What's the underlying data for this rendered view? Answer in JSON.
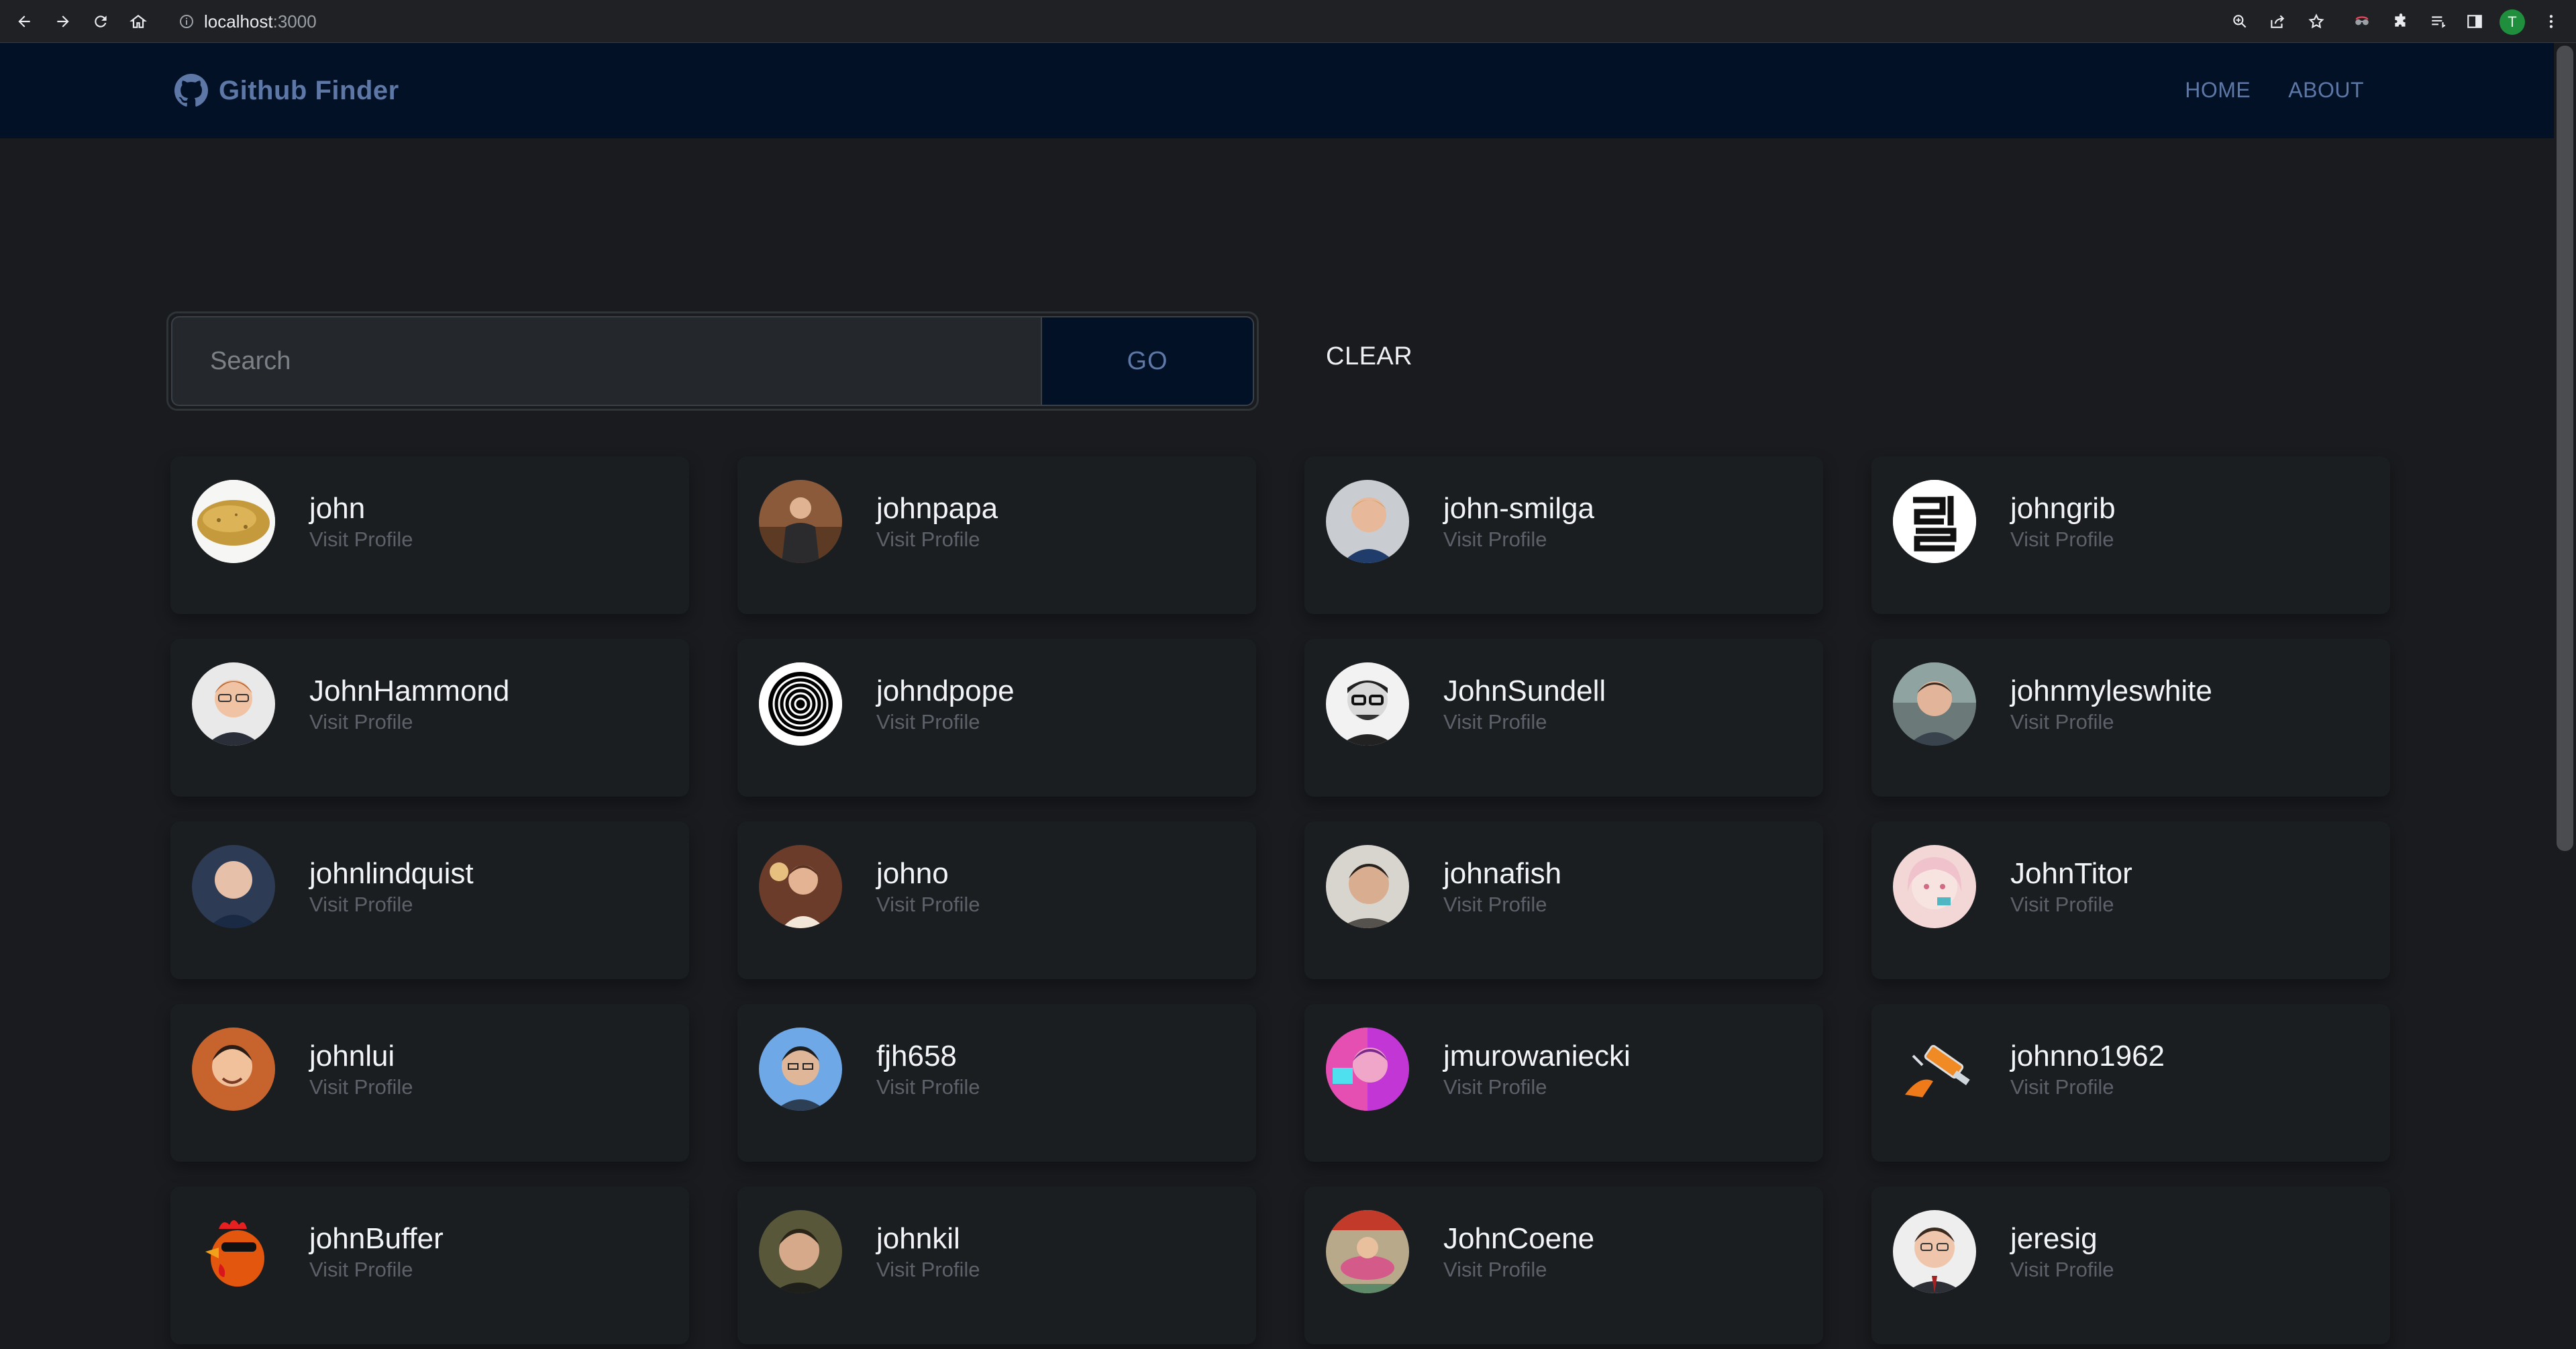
{
  "browser": {
    "url_host": "localhost",
    "url_port": ":3000",
    "profile_initial": "T"
  },
  "navbar": {
    "brand": "Github Finder",
    "links": [
      "HOME",
      "ABOUT"
    ]
  },
  "search": {
    "placeholder": "Search",
    "go_label": "GO",
    "clear_label": "CLEAR"
  },
  "users": [
    {
      "login": "john",
      "link_label": "Visit Profile"
    },
    {
      "login": "johnpapa",
      "link_label": "Visit Profile"
    },
    {
      "login": "john-smilga",
      "link_label": "Visit Profile"
    },
    {
      "login": "johngrib",
      "link_label": "Visit Profile"
    },
    {
      "login": "JohnHammond",
      "link_label": "Visit Profile"
    },
    {
      "login": "johndpope",
      "link_label": "Visit Profile"
    },
    {
      "login": "JohnSundell",
      "link_label": "Visit Profile"
    },
    {
      "login": "johnmyleswhite",
      "link_label": "Visit Profile"
    },
    {
      "login": "johnlindquist",
      "link_label": "Visit Profile"
    },
    {
      "login": "johno",
      "link_label": "Visit Profile"
    },
    {
      "login": "johnafish",
      "link_label": "Visit Profile"
    },
    {
      "login": "JohnTitor",
      "link_label": "Visit Profile"
    },
    {
      "login": "johnlui",
      "link_label": "Visit Profile"
    },
    {
      "login": "fjh658",
      "link_label": "Visit Profile"
    },
    {
      "login": "jmurowaniecki",
      "link_label": "Visit Profile"
    },
    {
      "login": "johnno1962",
      "link_label": "Visit Profile"
    },
    {
      "login": "johnBuffer",
      "link_label": "Visit Profile"
    },
    {
      "login": "johnkil",
      "link_label": "Visit Profile"
    },
    {
      "login": "JohnCoene",
      "link_label": "Visit Profile"
    },
    {
      "login": "jeresig",
      "link_label": "Visit Profile"
    }
  ]
}
